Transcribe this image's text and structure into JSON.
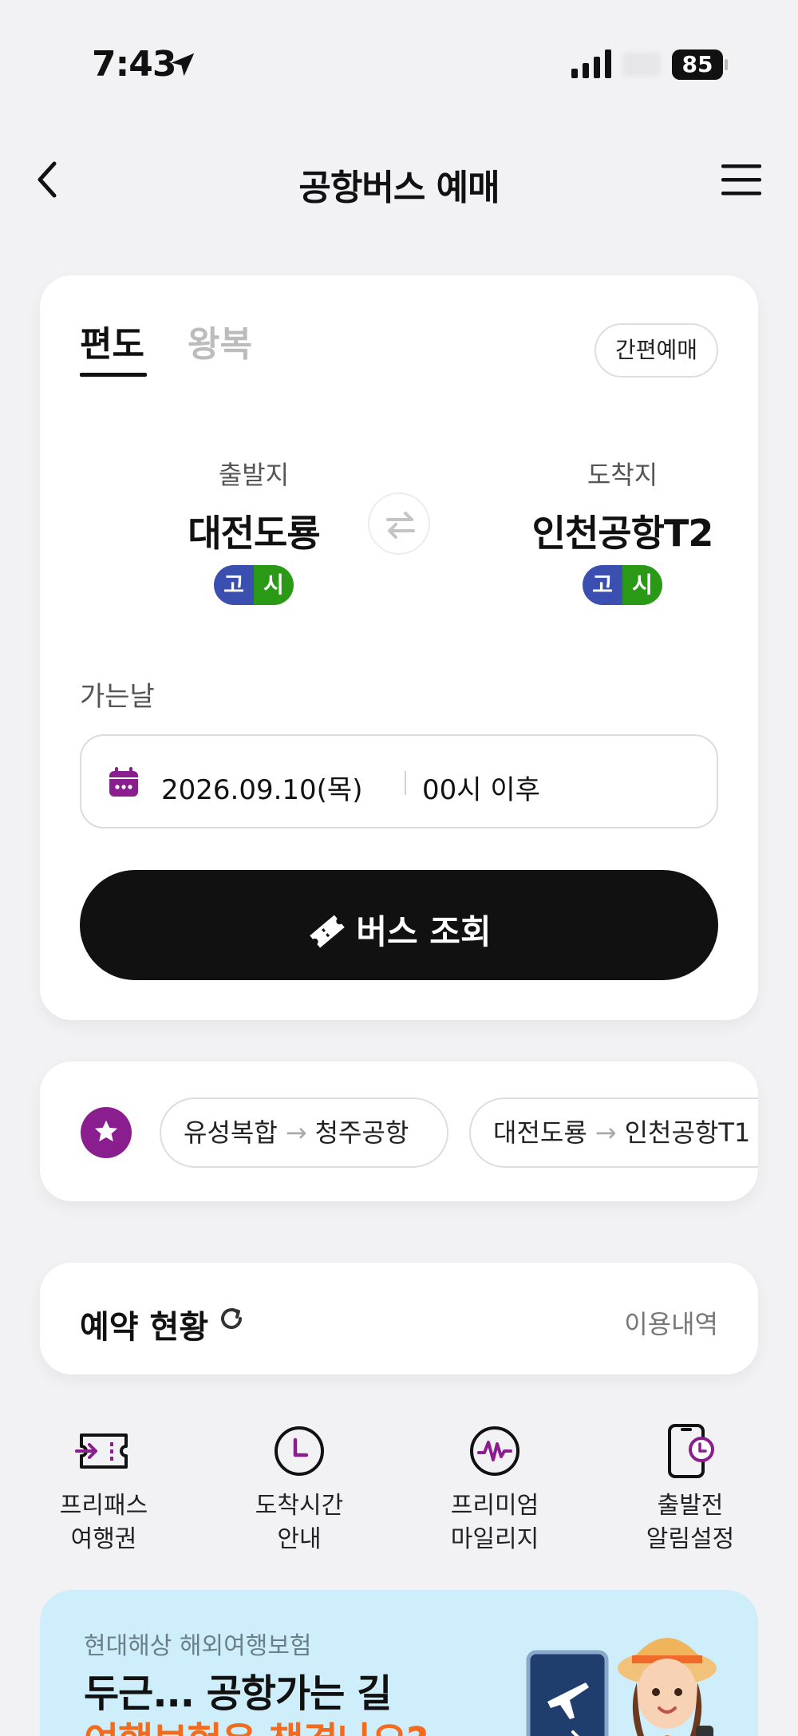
{
  "status_bar": {
    "time": "7:43",
    "battery": "85"
  },
  "header": {
    "title": "공항버스 예매"
  },
  "booking": {
    "tabs": [
      "편도",
      "왕복"
    ],
    "quick_booking_label": "간편예매",
    "departure": {
      "label": "출발지",
      "name": "대전도룡",
      "badges": [
        "고",
        "시"
      ]
    },
    "arrival": {
      "label": "도착지",
      "name": "인천공항T2",
      "badges": [
        "고",
        "시"
      ]
    },
    "date_label": "가는날",
    "date_value": "2026.09.10(목)",
    "time_value": "00시 이후",
    "search_label": "버스 조회"
  },
  "favorites": {
    "routes": [
      {
        "from": "유성복합",
        "to": "청주공항"
      },
      {
        "from": "대전도룡",
        "to": "인천공항T1"
      }
    ]
  },
  "reservation": {
    "title": "예약 현황",
    "history_link": "이용내역"
  },
  "quick_menu": [
    {
      "icon": "freepass-ticket-icon",
      "line1": "프리패스",
      "line2": "여행권"
    },
    {
      "icon": "clock-icon",
      "line1": "도착시간",
      "line2": "안내"
    },
    {
      "icon": "premium-mileage-icon",
      "line1": "프리미엄",
      "line2": "마일리지"
    },
    {
      "icon": "phone-alarm-icon",
      "line1": "출발전",
      "line2": "알림설정"
    }
  ],
  "banner": {
    "subtitle": "현대해상 해외여행보험",
    "title_line1": "두근... 공항가는 길",
    "title_line2": "여행보험은 챙겼나요?"
  },
  "colors": {
    "accent_purple": "#8b1e8f",
    "badge_blue": "#3a4fb0",
    "badge_green": "#2a9a16",
    "banner_bg": "#cdeefa",
    "banner_orange": "#f36b1c"
  }
}
